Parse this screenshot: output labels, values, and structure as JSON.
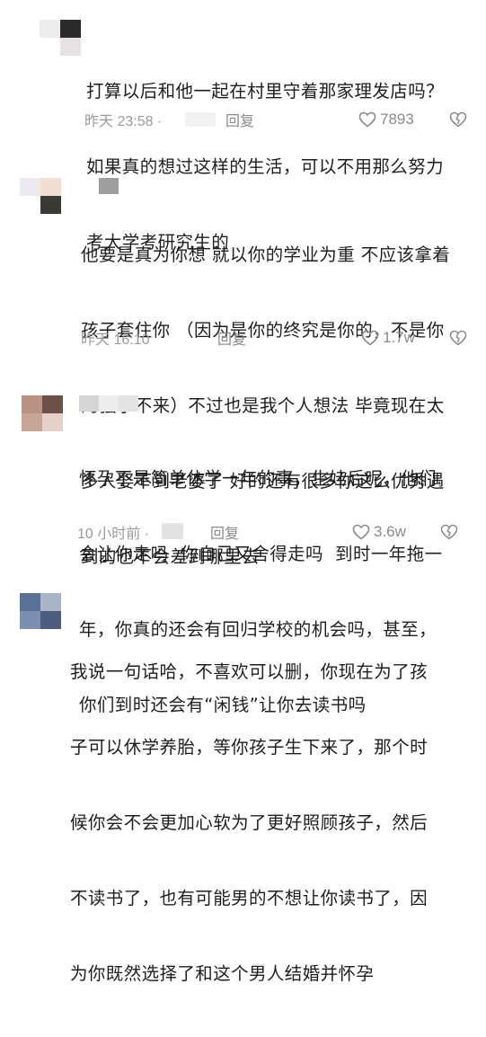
{
  "comments": [
    {
      "lines": [
        "打算以后和他一起在村里守着那家理发店吗？",
        "如果真的想过这样的生活，可以不用那么努力",
        "考大学考研究生的"
      ],
      "time": "昨天 23:58 ·",
      "reply": "回复",
      "likes": "7893"
    },
    {
      "lines": [
        "他要是真为你想 就以你的学业为重 不应该拿着",
        "孩子套住你 （因为是你的终究是你的，不是你",
        "的强求不来）不过也是我个人想法 毕竟现在太",
        "多人娶不到老婆了 好的还有很多你这么优秀遇",
        "到的也不会差到哪里去"
      ],
      "time": "昨天 16:10",
      "reply": "回复",
      "likes": "1.7w"
    },
    {
      "lines": [
        "怀孕不是简单休学一年的事，生娃后呢，他们",
        "会让你走吗  你自己又舍得走吗  到时一年拖一",
        "年，你真的还会有回归学校的机会吗，甚至，",
        "你们到时还会有“闲钱”让你去读书吗"
      ],
      "time": "10 小时前 ·",
      "reply": "回复",
      "likes": "3.6w"
    },
    {
      "lines": [
        "我说一句话哈，不喜欢可以删，你现在为了孩",
        "子可以休学养胎，等你孩子生下来了，那个时",
        "候你会不会更加心软为了更好照顾孩子，然后",
        "不读书了，也有可能男的不想让你读书了，因",
        "为你既然选择了和这个男人结婚并怀孕"
      ]
    }
  ],
  "icons": {
    "like": "heart-outline-icon",
    "dislike": "heart-broken-icon"
  },
  "colors": {
    "text": "#1e1e1e",
    "meta": "#9a9a9a",
    "icon": "#8a8a8a"
  }
}
